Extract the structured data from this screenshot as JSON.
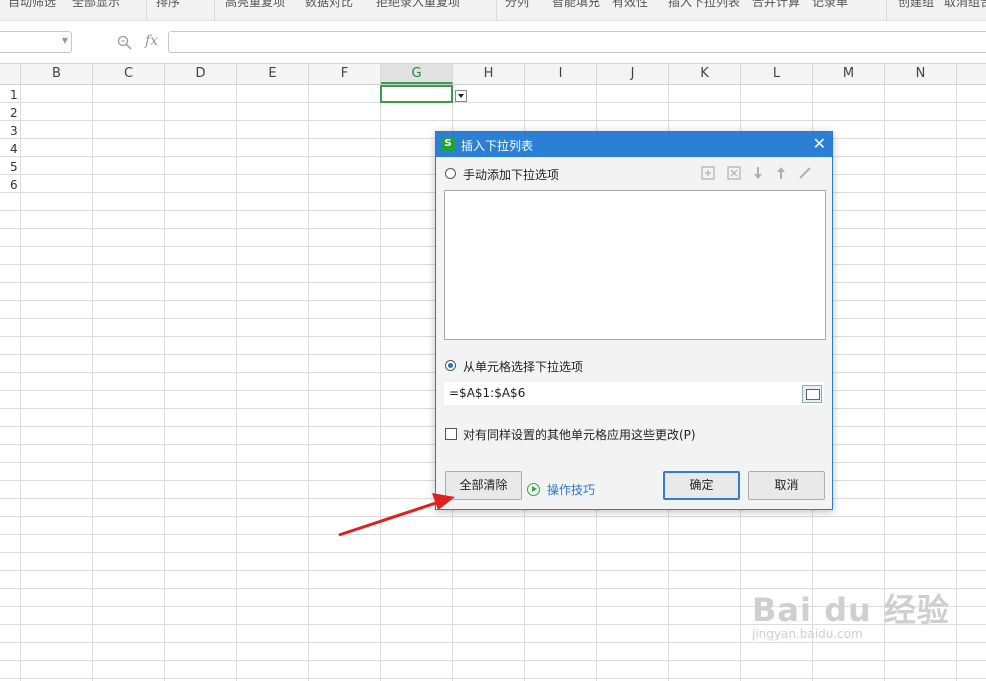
{
  "ribbon": {
    "items": [
      "自动筛选",
      "全部显示",
      "排序",
      "高亮重复项",
      "数据对比",
      "拒绝录入重复项",
      "分列",
      "智能填充",
      "有效性",
      "插入下拉列表",
      "合并计算",
      "记录单",
      "创建组",
      "取消组合"
    ]
  },
  "formula_bar": {
    "fx_label": "fx",
    "value": ""
  },
  "sheet": {
    "columns": [
      "B",
      "C",
      "D",
      "E",
      "F",
      "G",
      "H",
      "I",
      "J",
      "K",
      "L",
      "M",
      "N"
    ],
    "active_column": "G",
    "rows": [
      "1",
      "2",
      "3",
      "4",
      "5",
      "6"
    ]
  },
  "dialog": {
    "title": "插入下拉列表",
    "manual_option_label": "手动添加下拉选项",
    "cell_option_label": "从单元格选择下拉选项",
    "range_value": "=$A$1:$A$6",
    "apply_checkbox_label": "对有同样设置的其他单元格应用这些更改(P)",
    "clear_all_button": "全部清除",
    "tips_link": "操作技巧",
    "ok_button": "确定",
    "cancel_button": "取消",
    "selected_option": "cell"
  },
  "watermark": {
    "logo_text": "Bai du 经验",
    "url": "jingyan.baidu.com"
  },
  "colors": {
    "title_bar": "#2b7fd4",
    "selection_border": "#3d9a46",
    "annotation_arrow": "#e02020",
    "link": "#2e76c8"
  }
}
